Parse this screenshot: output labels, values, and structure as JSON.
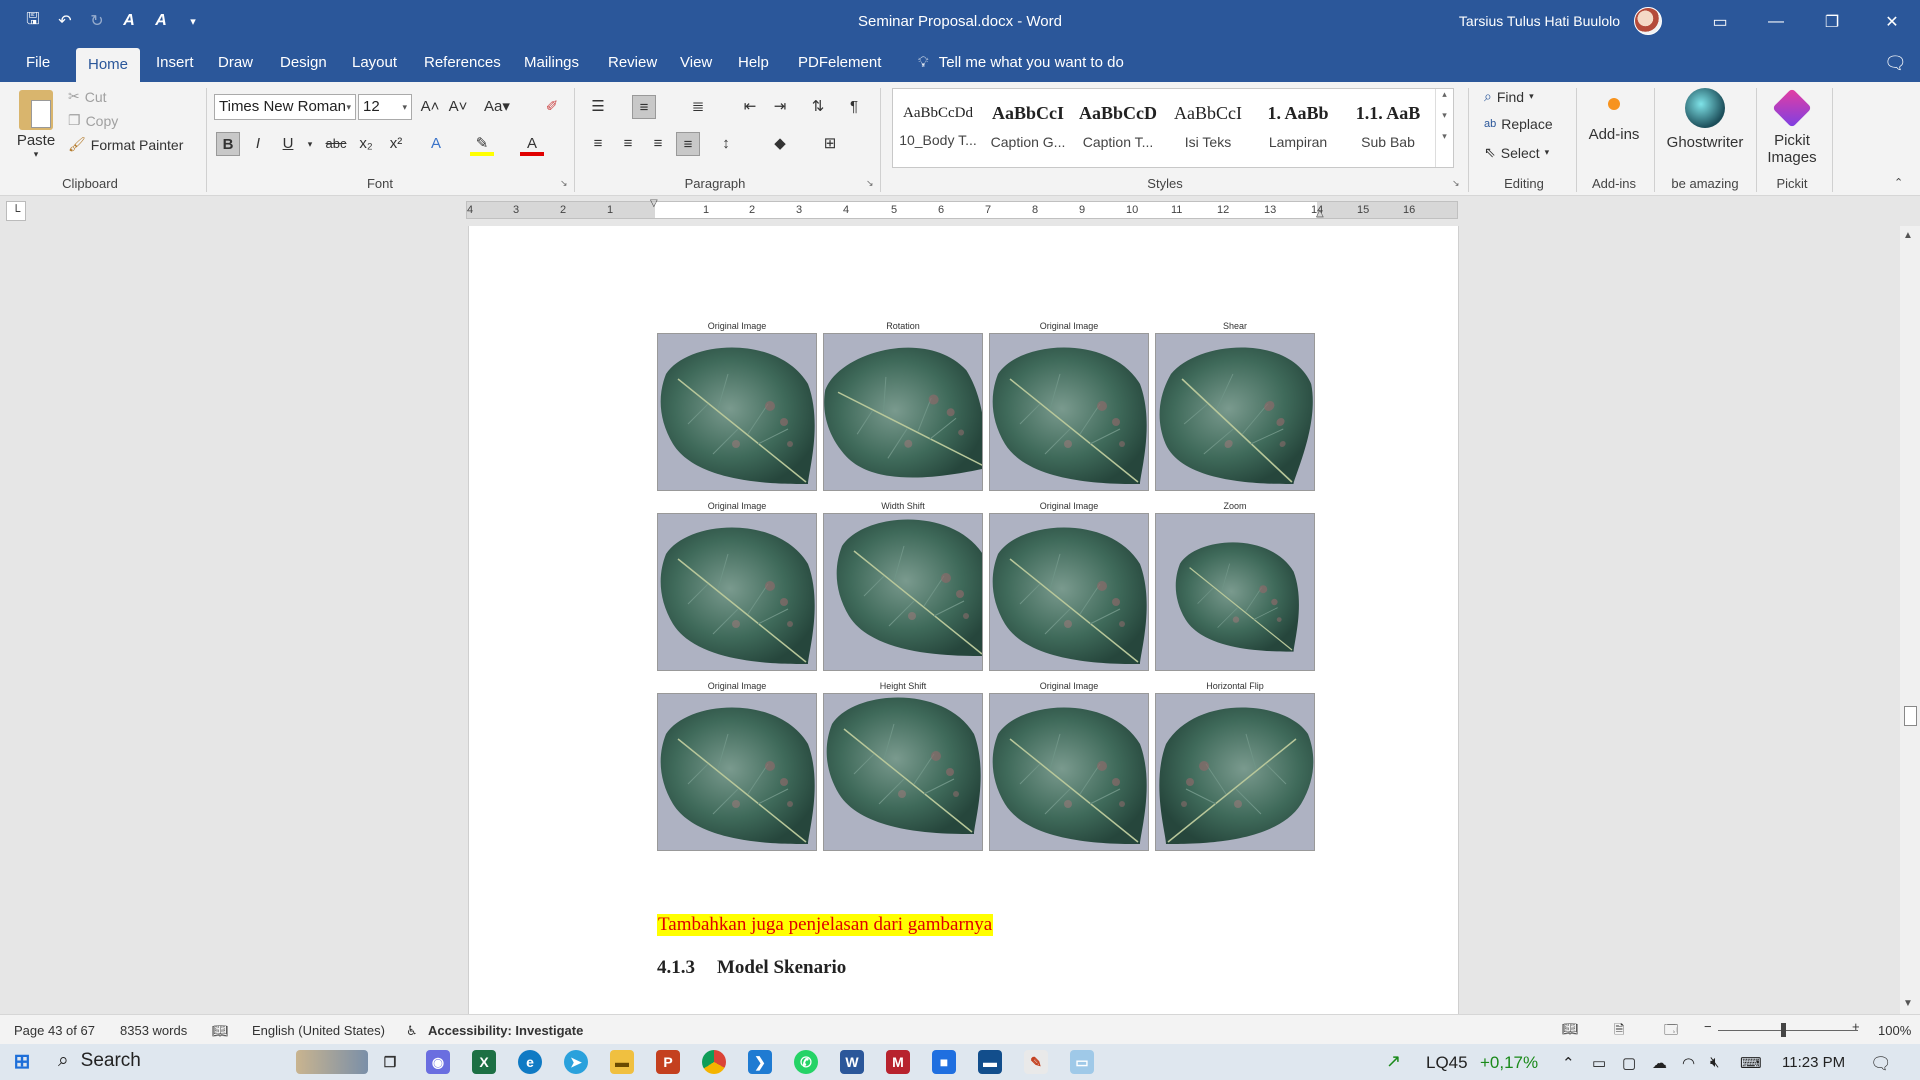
{
  "app": {
    "title": "Seminar Proposal.docx  -  Word",
    "user": "Tarsius Tulus Hati Buulolo"
  },
  "tabs": [
    "File",
    "Home",
    "Insert",
    "Draw",
    "Design",
    "Layout",
    "References",
    "Mailings",
    "Review",
    "View",
    "Help",
    "PDFelement"
  ],
  "tell_me": "Tell me what you want to do",
  "clipboard": {
    "paste": "Paste",
    "cut": "Cut",
    "copy": "Copy",
    "format_painter": "Format Painter",
    "label": "Clipboard"
  },
  "font": {
    "name": "Times New Roman",
    "size": "12",
    "label": "Font"
  },
  "paragraph": {
    "label": "Paragraph"
  },
  "styles": {
    "label": "Styles",
    "items": [
      {
        "preview": "AaBbCcDd",
        "name": "10_Body T..."
      },
      {
        "preview": "AaBbCcI",
        "name": "Caption G..."
      },
      {
        "preview": "AaBbCcD",
        "name": "Caption T..."
      },
      {
        "preview": "AaBbCcI",
        "name": "Isi Teks"
      },
      {
        "preview": "1.  AaBb",
        "name": "Lampiran"
      },
      {
        "preview": "1.1.  AaB",
        "name": "Sub Bab"
      }
    ]
  },
  "editing": {
    "find": "Find",
    "replace": "Replace",
    "select": "Select",
    "label": "Editing"
  },
  "addins": {
    "button": "Add-ins",
    "label": "Add-ins"
  },
  "ghostwriter": {
    "button": "Ghostwriter",
    "label": "be amazing"
  },
  "pickit": {
    "button_line1": "Pickit",
    "button_line2": "Images",
    "label": "Pickit"
  },
  "ruler_numbers": [
    "4",
    "3",
    "2",
    "1",
    "1",
    "2",
    "3",
    "4",
    "5",
    "6",
    "7",
    "8",
    "9",
    "10",
    "11",
    "12",
    "13",
    "14",
    "15",
    "16"
  ],
  "document": {
    "figure_captions": [
      "Original Image",
      "Rotation",
      "Original Image",
      "Shear",
      "Original Image",
      "Width Shift",
      "Original Image",
      "Zoom",
      "Original Image",
      "Height Shift",
      "Original Image",
      "Horizontal Flip"
    ],
    "highlight_note": "Tambahkan juga penjelasan dari gambarnya",
    "heading_number": "4.1.3",
    "heading_text": "Model Skenario"
  },
  "status": {
    "page": "Page 43 of 67",
    "words": "8353 words",
    "language": "English (United States)",
    "accessibility": "Accessibility: Investigate",
    "zoom": "100%"
  },
  "taskbar": {
    "search": "Search",
    "stock_name": "LQ45",
    "stock_change": "+0,17%",
    "time": "11:23 PM"
  },
  "colors": {
    "brand": "#2b579a",
    "highlight": "#ffff00",
    "note_text": "#e00000",
    "stock_up": "#1a8a1a"
  }
}
